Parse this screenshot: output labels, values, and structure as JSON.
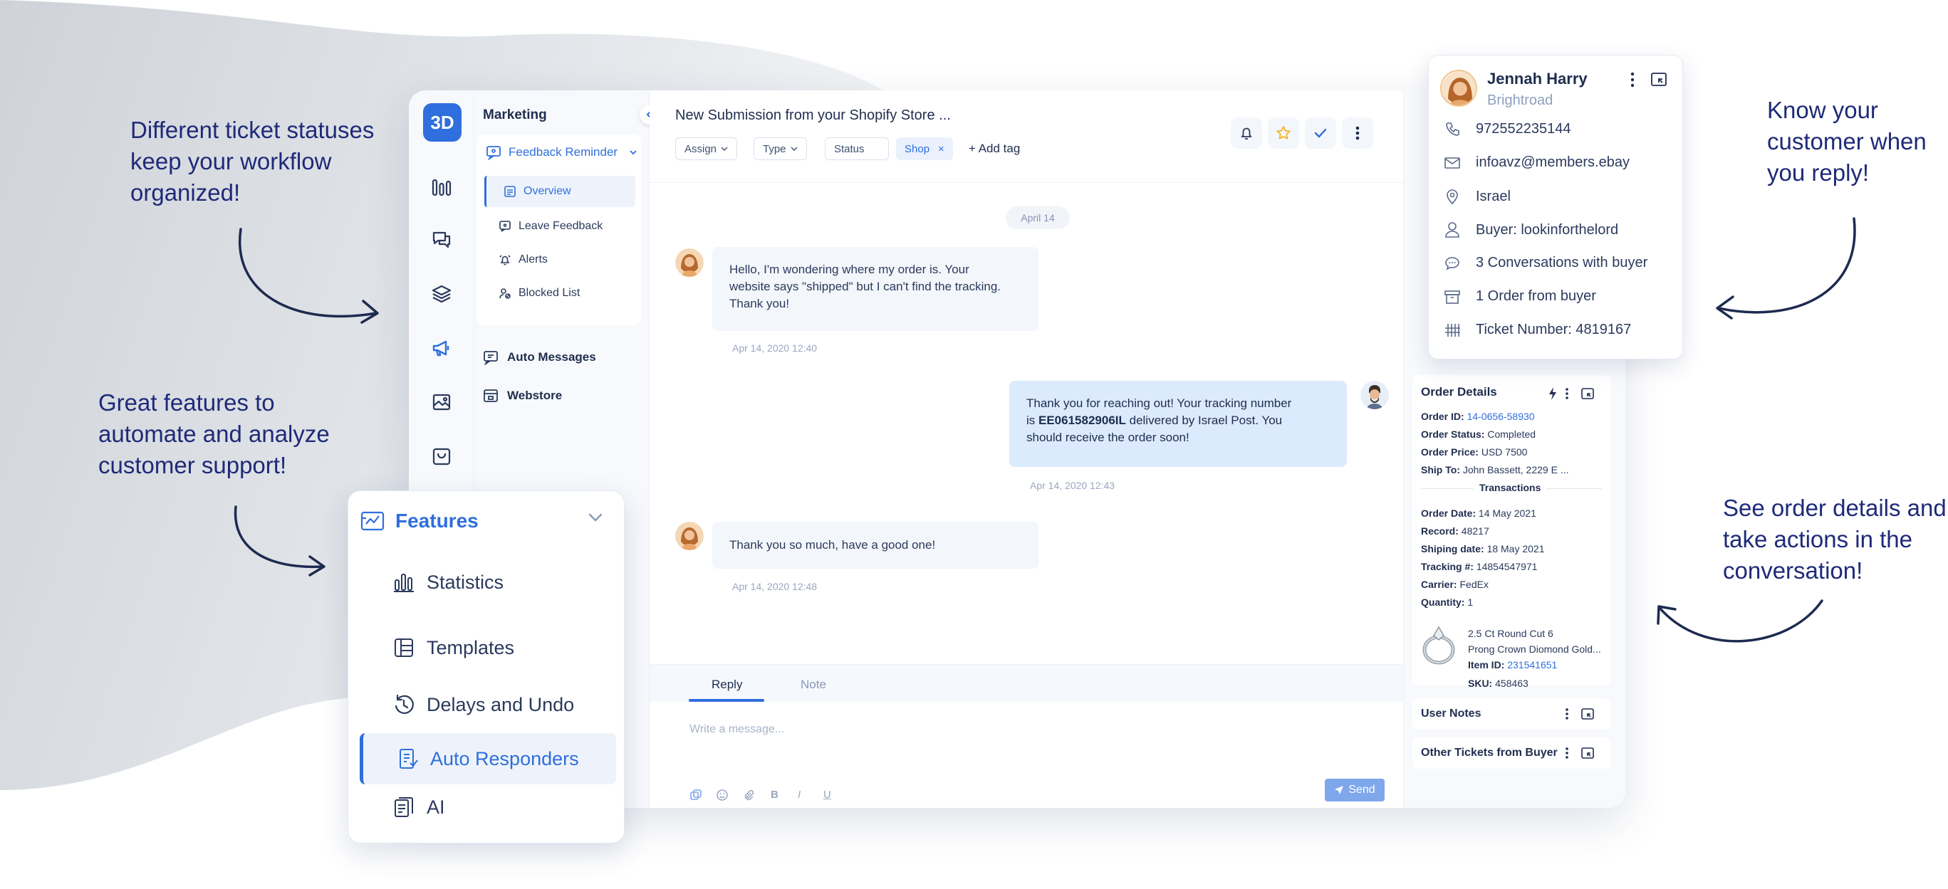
{
  "captions": {
    "statuses": [
      "Different ticket statuses",
      "keep your workflow",
      "organized!"
    ],
    "features": [
      "Great features to",
      "automate and analyze",
      "customer support!"
    ],
    "know": [
      "Know your",
      "customer when",
      "you reply!"
    ],
    "order": [
      "See order details and",
      "take actions in the",
      "conversation!"
    ]
  },
  "app": {
    "logo": "3D",
    "subnav": {
      "title": "Marketing",
      "group_label": "Feedback Reminder",
      "items": [
        "Overview",
        "Leave Feedback",
        "Alerts",
        "Blocked List"
      ],
      "nav": [
        "Auto Messages",
        "Webstore"
      ]
    },
    "conversation": {
      "title": "New Submission from your Shopify Store ...",
      "chips": {
        "assign": "Assign",
        "type": "Type",
        "status": "Status",
        "shop": "Shop"
      },
      "add_tag": "+ Add tag",
      "date_divider": "April 14",
      "messages": [
        {
          "text": [
            "Hello, I'm wondering where my order is. Your",
            "website says \"shipped\" but I can't find the tracking.",
            "Thank you!"
          ],
          "time": "Apr 14, 2020 12:40"
        },
        {
          "text_pre": "Thank you for reaching out! Your tracking number",
          "text_mid_pre": "is ",
          "tracking": "EE061582906IL",
          "text_mid_post": " delivered by Israel Post. You",
          "text_post": "should receive the order soon!",
          "time": "Apr 14, 2020 12:43"
        },
        {
          "text": "Thank you so much, have a good one!",
          "time": "Apr 14, 2020 12:48"
        }
      ],
      "tabs": {
        "reply": "Reply",
        "note": "Note"
      },
      "placeholder": "Write a message...",
      "send": "Send"
    },
    "order_details": {
      "title": "Order Details",
      "lines": [
        {
          "label": "Order ID:",
          "value": "14-0656-58930",
          "link": true
        },
        {
          "label": "Order Status:",
          "value": "Completed"
        },
        {
          "label": "Order Price:",
          "value": "USD 7500"
        },
        {
          "label": "Ship To:",
          "value": "John Bassett, 2229 E ..."
        }
      ],
      "transactions_title": "Transactions",
      "transactions": [
        {
          "label": "Order Date:",
          "value": "14 May 2021"
        },
        {
          "label": "Record:",
          "value": "48217"
        },
        {
          "label": "Shiping date:",
          "value": "18 May 2021"
        },
        {
          "label": "Tracking #:",
          "value": "14854547971"
        },
        {
          "label": "Carrier:",
          "value": "FedEx"
        },
        {
          "label": "Quantity:",
          "value": "1"
        }
      ],
      "item": {
        "name1": "2.5 Ct Round Cut 6",
        "name2": "Prong Crown Diomond Gold...",
        "id_label": "Item ID:",
        "id": "231541651",
        "sku_label": "SKU:",
        "sku": "458463"
      }
    },
    "user_notes": "User Notes",
    "other_tickets": "Other Tickets from Buyer"
  },
  "customer": {
    "name": "Jennah Harry",
    "company": "Brightroad",
    "rows": [
      {
        "icon": "phone-icon",
        "text": "972552235144"
      },
      {
        "icon": "mail-icon",
        "text": "infoavz@members.ebay"
      },
      {
        "icon": "location-icon",
        "text": "Israel"
      },
      {
        "icon": "user-icon",
        "text": "Buyer: lookinforthelord"
      },
      {
        "icon": "chat-icon",
        "text": "3 Conversations with buyer"
      },
      {
        "icon": "box-icon",
        "text": "1 Order from buyer"
      },
      {
        "icon": "ticket-icon",
        "text": "Ticket Number: 4819167"
      }
    ]
  },
  "features": {
    "title": "Features",
    "items": [
      "Statistics",
      "Templates",
      "Delays and Undo",
      "Auto Responders",
      "AI"
    ]
  },
  "colors": {
    "accent": "#2f6fdd",
    "caption": "#1e2a78",
    "wave": "#d7dadf"
  }
}
